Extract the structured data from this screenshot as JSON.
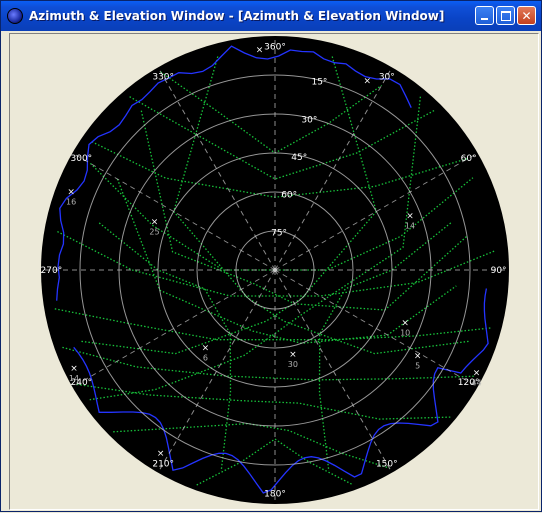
{
  "window": {
    "title": "Azimuth & Elevation Window - [Azimuth & Elevation Window]",
    "min_icon": "minimize-icon",
    "max_icon": "maximize-icon",
    "close_icon": "close-icon"
  },
  "colors": {
    "background": "#000000",
    "grid": "#c8c8c8",
    "track_green": "#17c23a",
    "track_blue": "#2434ff",
    "label": "#ffffff",
    "sat_label": "#b0b0b0"
  },
  "azimuth_labels": [
    {
      "az": 0,
      "text": "360°"
    },
    {
      "az": 30,
      "text": "30°"
    },
    {
      "az": 60,
      "text": "60°"
    },
    {
      "az": 90,
      "text": "90°"
    },
    {
      "az": 120,
      "text": "120°"
    },
    {
      "az": 150,
      "text": "150°"
    },
    {
      "az": 180,
      "text": "180°"
    },
    {
      "az": 210,
      "text": "210°"
    },
    {
      "az": 240,
      "text": "240°"
    },
    {
      "az": 270,
      "text": "270°"
    },
    {
      "az": 300,
      "text": "300°"
    },
    {
      "az": 330,
      "text": "330°"
    }
  ],
  "elevation_labels": [
    {
      "el": 15,
      "text": "15°"
    },
    {
      "el": 30,
      "text": "30°"
    },
    {
      "el": 45,
      "text": "45°"
    },
    {
      "el": 60,
      "text": "60°"
    },
    {
      "el": 75,
      "text": "75°"
    }
  ],
  "satellites": [
    {
      "id": "16",
      "az": 291,
      "el": 6
    },
    {
      "id": "25",
      "az": 292,
      "el": 40
    },
    {
      "id": "14",
      "az": 68,
      "el": 34
    },
    {
      "id": "30",
      "az": 168,
      "el": 57
    },
    {
      "id": "6",
      "az": 222,
      "el": 50
    },
    {
      "id": "10",
      "az": 112,
      "el": 36
    },
    {
      "id": "5",
      "az": 121,
      "el": 26
    },
    {
      "id": "44",
      "az": 117,
      "el": 3
    },
    {
      "id": "14",
      "az": 244,
      "el": 4
    },
    {
      "id": "",
      "az": 212,
      "el": 7
    },
    {
      "id": "",
      "az": 356,
      "el": 5
    },
    {
      "id": "",
      "az": 26,
      "el": 9
    }
  ]
}
